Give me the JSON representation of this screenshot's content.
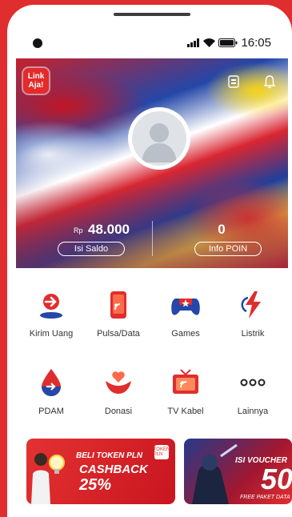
{
  "status": {
    "time": "16:05"
  },
  "header": {
    "logo_text": "Link Aja!"
  },
  "wallet": {
    "currency": "Rp",
    "balance": "48.000",
    "topup_label": "Isi Saldo",
    "points": "0",
    "points_label": "Info POIN"
  },
  "menu": [
    {
      "label": "Kirim Uang",
      "icon": "send-money-icon"
    },
    {
      "label": "Pulsa/Data",
      "icon": "phone-credit-icon"
    },
    {
      "label": "Games",
      "icon": "gamepad-icon"
    },
    {
      "label": "Listrik",
      "icon": "electricity-icon"
    },
    {
      "label": "PDAM",
      "icon": "water-drop-icon"
    },
    {
      "label": "Donasi",
      "icon": "donation-icon"
    },
    {
      "label": "TV Kabel",
      "icon": "tv-icon"
    },
    {
      "label": "Lainnya",
      "icon": "more-icon"
    }
  ],
  "banners": [
    {
      "line1": "BELI TOKEN PLN",
      "line2": "CASHBACK",
      "pct": "25%",
      "tag": "TOKEN PLN"
    },
    {
      "line1": "ISI VOUCHER",
      "big": "50",
      "sub": "FREE PAKET DATA"
    }
  ],
  "colors": {
    "brand": "#e02d2d",
    "accent_blue": "#2447a8"
  }
}
